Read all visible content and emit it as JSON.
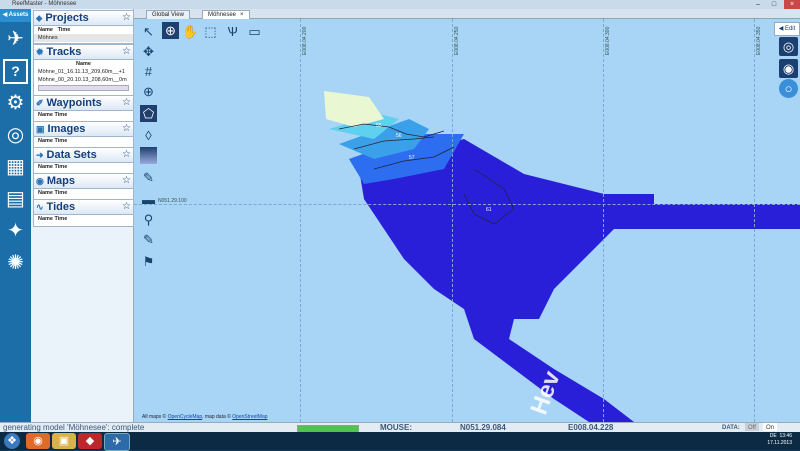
{
  "window": {
    "title": "ReefMaster - Möhnesee"
  },
  "rail": {
    "header": "◀ Assets",
    "icons": [
      "wave-logo-icon",
      "help-icon",
      "settings-gear-icon",
      "globe-icon",
      "import-icon",
      "folder-icon",
      "satellite-icon",
      "spinner-icon"
    ]
  },
  "sections": {
    "projects": {
      "title": "Projects",
      "cols": [
        "Name",
        "Time"
      ],
      "rows": [
        "Möhnes"
      ]
    },
    "tracks": {
      "title": "Tracks",
      "cols": [
        "Name"
      ],
      "rows": [
        "Möhne_01_16.11.13_209,60m__+1",
        "Möhne_00_20.10.13_208,60m__0m"
      ]
    },
    "waypoints": {
      "title": "Waypoints",
      "cols": [
        "Name",
        "Time"
      ]
    },
    "images": {
      "title": "Images",
      "cols": [
        "Name",
        "Time"
      ]
    },
    "datasets": {
      "title": "Data Sets",
      "cols": [
        "Name",
        "Time"
      ]
    },
    "maps": {
      "title": "Maps",
      "cols": [
        "Name",
        "Time"
      ]
    },
    "tides": {
      "title": "Tides",
      "cols": [
        "Name",
        "Time"
      ]
    }
  },
  "tabs": [
    {
      "label": "Global View"
    },
    {
      "label": "Möhnesee",
      "active": true
    }
  ],
  "map": {
    "lon_labels": [
      "E008.04.200",
      "E008.04.250",
      "E008.04.300",
      "E008.04.350"
    ],
    "lat_label": "N051.29.100",
    "contours": [
      "55",
      "56",
      "57",
      "61"
    ],
    "edit_label": "◀ Edit",
    "attribution_prefix": "All maps ©",
    "attribution_link1": "OpenCycleMap",
    "attribution_mid": ", map data ©",
    "attribution_link2": "OpenStreetMap",
    "watermark": "Hev"
  },
  "status": {
    "message": "generating model 'Möhnesee': complete",
    "progress": 1.0,
    "mouse_label": "MOUSE:",
    "mouse_lat": "N051.29.084",
    "mouse_lon": "E008.04.228",
    "data_label": "DATA:",
    "off": "Off",
    "on": "On"
  },
  "taskbar": {
    "lang": "DE",
    "time": "13:46",
    "date": "17.11.2013"
  },
  "colors": {
    "accent": "#1b6ea8",
    "water": "#a8d4f5",
    "deep": "#2a1fd8"
  }
}
